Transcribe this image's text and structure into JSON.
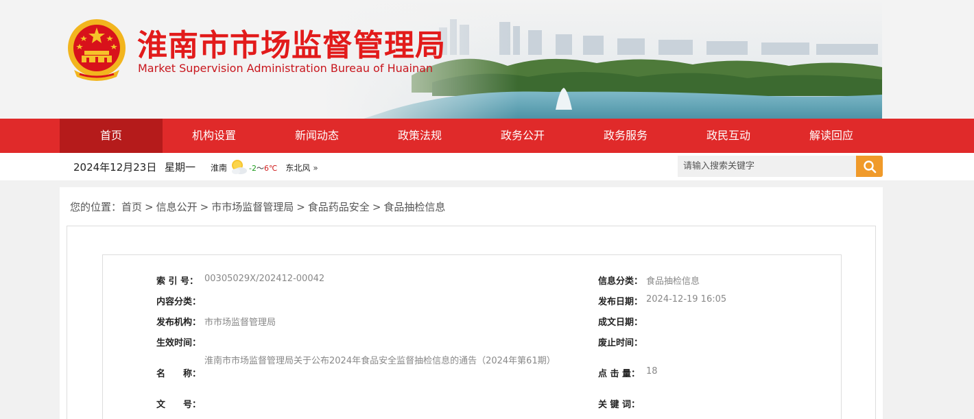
{
  "header": {
    "title": "淮南市市场监督管理局",
    "subtitle": "Market Supervision Administration Bureau of Huainan",
    "emblem_icon": "national-emblem-icon"
  },
  "nav": {
    "items": [
      "首页",
      "机构设置",
      "新闻动态",
      "政策法规",
      "政务公开",
      "政务服务",
      "政民互动",
      "解读回应"
    ],
    "active_index": 0
  },
  "infobar": {
    "date": "2024年12月23日",
    "weekday": "星期一",
    "weather": {
      "city": "淮南",
      "icon": "sun-cloud-icon",
      "low": "-2",
      "sep": "～",
      "high": "6℃",
      "wind": "东北风",
      "more": "»"
    },
    "search": {
      "placeholder": "请输入搜索关键字",
      "button_icon": "search-icon"
    }
  },
  "breadcrumb": {
    "prefix": "您的位置：",
    "items": [
      "首页",
      "信息公开",
      "市市场监督管理局",
      "食品药品安全",
      "食品抽检信息"
    ],
    "separator": ">"
  },
  "info": {
    "left": [
      {
        "label": "索 引 号：",
        "value": "00305029X/202412-00042"
      },
      {
        "label": "内容分类：",
        "value": ""
      },
      {
        "label": "发布机构：",
        "value": "市市场监督管理局"
      },
      {
        "label": "生效时间：",
        "value": ""
      },
      {
        "label": "名　　称：",
        "value": "淮南市市场监督管理局关于公布2024年食品安全监督抽检信息的通告（2024年第61期）"
      },
      {
        "label": "文　　号：",
        "value": ""
      }
    ],
    "right": [
      {
        "label": "信息分类：",
        "value": "食品抽检信息"
      },
      {
        "label": "发布日期：",
        "value": "2024-12-19 16:05"
      },
      {
        "label": "成文日期：",
        "value": ""
      },
      {
        "label": "废止时间：",
        "value": ""
      },
      {
        "label": "点 击 量：",
        "value": "18"
      },
      {
        "label": "关 键 词：",
        "value": ""
      }
    ]
  },
  "colors": {
    "brand_red": "#e21b1b",
    "nav_red": "#e02a2a",
    "nav_active": "#b51b1b",
    "search_orange": "#f09a2a"
  }
}
